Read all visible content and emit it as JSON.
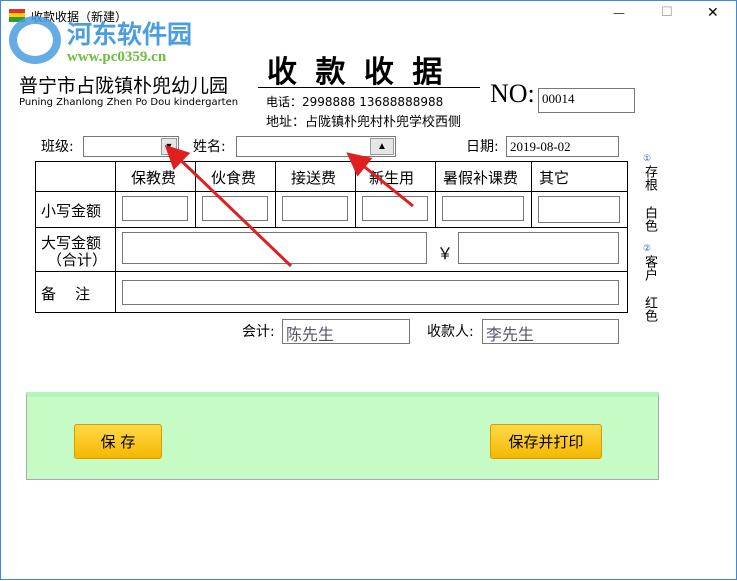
{
  "window": {
    "title": "收款收据（新建）",
    "minimize": "—",
    "maximize": "☐",
    "close": "✕"
  },
  "watermark": {
    "name": "河东软件园",
    "url": "www.pc0359.cn"
  },
  "header": {
    "school_cn": "普宁市占陇镇朴兜幼儿园",
    "school_en": "Puning Zhanlong Zhen Po Dou kindergarten",
    "title": "收 款 收 据",
    "phone": "电话：2998888    13688888988",
    "address": "地址：占陇镇朴兜村朴兜学校西侧",
    "no_label": "NO:",
    "no_value": "00014"
  },
  "form": {
    "class_label": "班级:",
    "class_value": "",
    "name_label": "姓名:",
    "name_value": "",
    "date_label": "日期:",
    "date_value": "2019-08-02"
  },
  "table": {
    "columns": [
      "保教费",
      "伙食费",
      "接送费",
      "新生用",
      "暑假补课费",
      "其它"
    ],
    "row_small": "小写金额",
    "row_big_1": "大写金额",
    "row_big_2": "（合计）",
    "yen": "￥",
    "row_note": "备    注"
  },
  "signers": {
    "accountant_label": "会计:",
    "accountant_value": "陈先生",
    "payee_label": "收款人:",
    "payee_value": "李先生"
  },
  "side": {
    "n1": "①",
    "copy1": "存根",
    "color1": "白色",
    "n2": "②",
    "copy2": "客户",
    "color2": "红色"
  },
  "buttons": {
    "save": "保 存",
    "save_print": "保存并打印"
  }
}
